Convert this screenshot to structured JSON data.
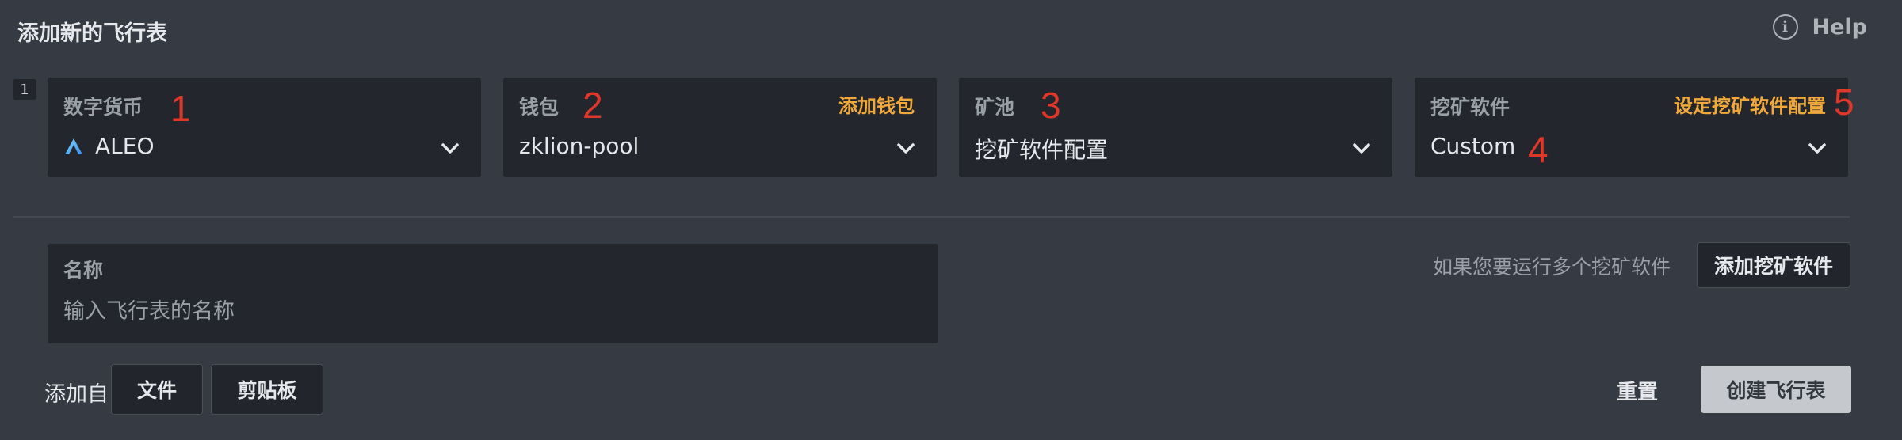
{
  "header": {
    "title": "添加新的飞行表",
    "help_label": "Help",
    "help_icon": "info-icon"
  },
  "row_number": "1",
  "fields": {
    "coin": {
      "label": "数字货币",
      "value": "ALEO",
      "icon": "aleo-logo-icon",
      "annotation": "1"
    },
    "wallet": {
      "label": "钱包",
      "action": "添加钱包",
      "value": "zklion-pool",
      "annotation": "2"
    },
    "pool": {
      "label": "矿池",
      "value": "挖矿软件配置",
      "annotation": "3"
    },
    "miner": {
      "label": "挖矿软件",
      "action": "设定挖矿软件配置",
      "value": "Custom",
      "value_annotation": "4",
      "action_annotation": "5"
    }
  },
  "name": {
    "label": "名称",
    "placeholder": "输入飞行表的名称",
    "value": ""
  },
  "multi_miner": {
    "hint": "如果您要运行多个挖矿软件",
    "button": "添加挖矿软件"
  },
  "footer": {
    "add_from": "添加自",
    "file_button": "文件",
    "clipboard_button": "剪贴板",
    "reset": "重置",
    "create": "创建飞行表"
  },
  "colors": {
    "background": "#353a43",
    "field": "#23262c",
    "accent": "#f0a93a",
    "annotation": "#e0372b",
    "primary_button": "#c5c9ce"
  }
}
